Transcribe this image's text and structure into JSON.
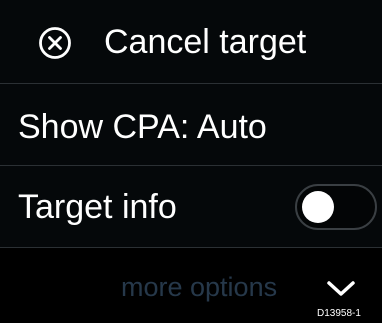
{
  "menu": {
    "cancel_target": {
      "label": "Cancel target",
      "icon": "cancel-circle-icon"
    },
    "show_cpa": {
      "label": "Show CPA: Auto"
    },
    "target_info": {
      "label": "Target info",
      "toggle_state": "off"
    },
    "more_options": {
      "label": "more options",
      "icon": "chevron-down-icon"
    }
  },
  "figure_code": "D13958-1",
  "colors": {
    "background": "#000000",
    "text": "#ffffff",
    "more_options_text": "#26384a",
    "toggle_knob": "#ffffff"
  }
}
